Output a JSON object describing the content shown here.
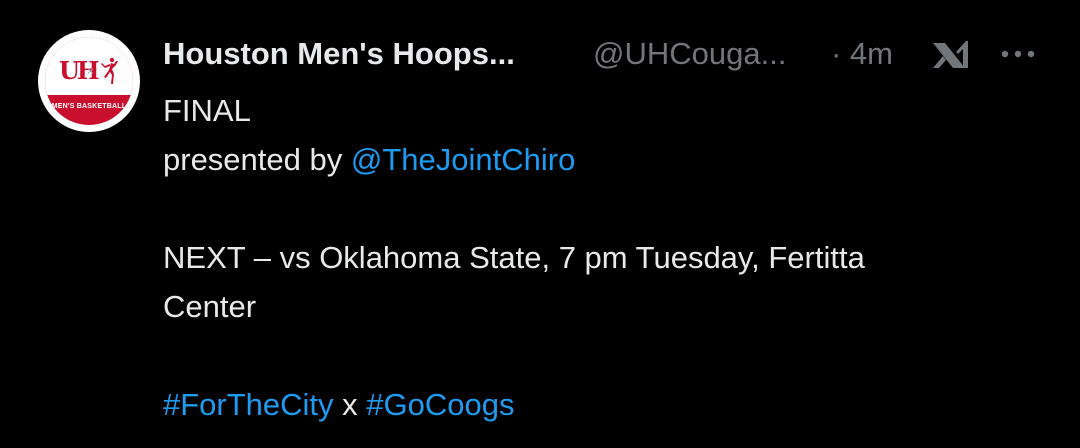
{
  "tweet": {
    "display_name": "Houston Men's Hoops...",
    "handle": "@UHCouga...",
    "timestamp": "· 4m",
    "avatar_caption": "MEN'S BASKETBALL",
    "avatar_monogram": "UH",
    "avatar_separator": "×",
    "lines": {
      "final": "FINAL",
      "presented_prefix": "presented by ",
      "presented_mention": "@TheJointChiro",
      "next_line_1": "NEXT – vs Oklahoma State, 7 pm Tuesday, Fertitta",
      "next_line_2": "Center",
      "hashtag_1": "#ForTheCity",
      "hashtag_sep": " x ",
      "hashtag_2": "#GoCoogs"
    }
  },
  "icons": {
    "grok": "grok-icon",
    "more": "more-options-icon"
  },
  "colors": {
    "background": "#000000",
    "text": "#e7e9ea",
    "muted": "#71767b",
    "link": "#1d9bf0",
    "brand_red": "#c8102e"
  }
}
